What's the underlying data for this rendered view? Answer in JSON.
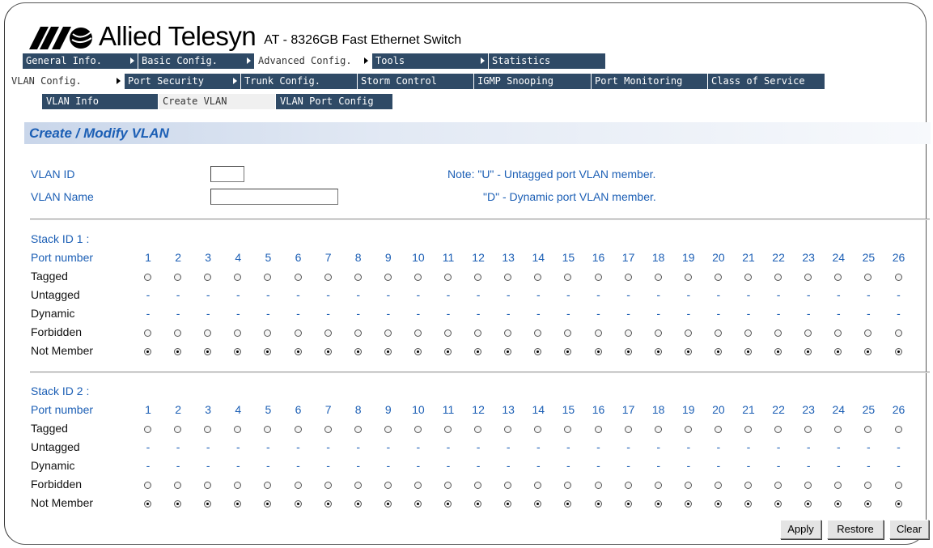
{
  "header": {
    "brand": "Allied Telesyn",
    "model": "AT - 8326GB Fast Ethernet Switch",
    "logo_color": "#000000"
  },
  "nav_main": [
    {
      "label": "General Info.",
      "arrow": true
    },
    {
      "label": "Basic Config.",
      "arrow": true
    },
    {
      "label": "Advanced Config.",
      "arrow": true,
      "active": true
    },
    {
      "label": "Tools",
      "arrow": true
    },
    {
      "label": "Statistics",
      "arrow": false
    }
  ],
  "nav_advanced": [
    {
      "label": "VLAN Config.",
      "arrow": true,
      "active": true
    },
    {
      "label": "Port Security",
      "arrow": true
    },
    {
      "label": "Trunk Config.",
      "arrow": false
    },
    {
      "label": "Storm Control",
      "arrow": false
    },
    {
      "label": "IGMP Snooping",
      "arrow": false
    },
    {
      "label": "Port Monitoring",
      "arrow": false
    },
    {
      "label": "Class of Service",
      "arrow": false
    }
  ],
  "nav_vlan": [
    {
      "label": "VLAN Info"
    },
    {
      "label": "Create VLAN",
      "active": true
    },
    {
      "label": "VLAN Port Config"
    }
  ],
  "page": {
    "title": "Create / Modify VLAN",
    "vlan_id_label": "VLAN ID",
    "vlan_id_value": "",
    "vlan_name_label": "VLAN Name",
    "vlan_name_value": "",
    "note1": "Note: \"U\" - Untagged port VLAN member.",
    "note2": "\"D\" - Dynamic port VLAN member."
  },
  "stacks": [
    {
      "label": "Stack ID 1 :"
    },
    {
      "label": "Stack ID 2 :"
    }
  ],
  "rows": {
    "port_number": "Port number",
    "tagged": "Tagged",
    "untagged": "Untagged",
    "dynamic": "Dynamic",
    "forbidden": "Forbidden",
    "not_member": "Not Member"
  },
  "ports": [
    "1",
    "2",
    "3",
    "4",
    "5",
    "6",
    "7",
    "8",
    "9",
    "10",
    "11",
    "12",
    "13",
    "14",
    "15",
    "16",
    "17",
    "18",
    "19",
    "20",
    "21",
    "22",
    "23",
    "24",
    "25",
    "26"
  ],
  "selected_membership": "not_member",
  "dash": "-",
  "buttons": {
    "apply": "Apply",
    "restore": "Restore",
    "clear": "Clear"
  },
  "colors": {
    "nav_bg": "#2f4a66",
    "label_blue": "#1c5fb5"
  }
}
